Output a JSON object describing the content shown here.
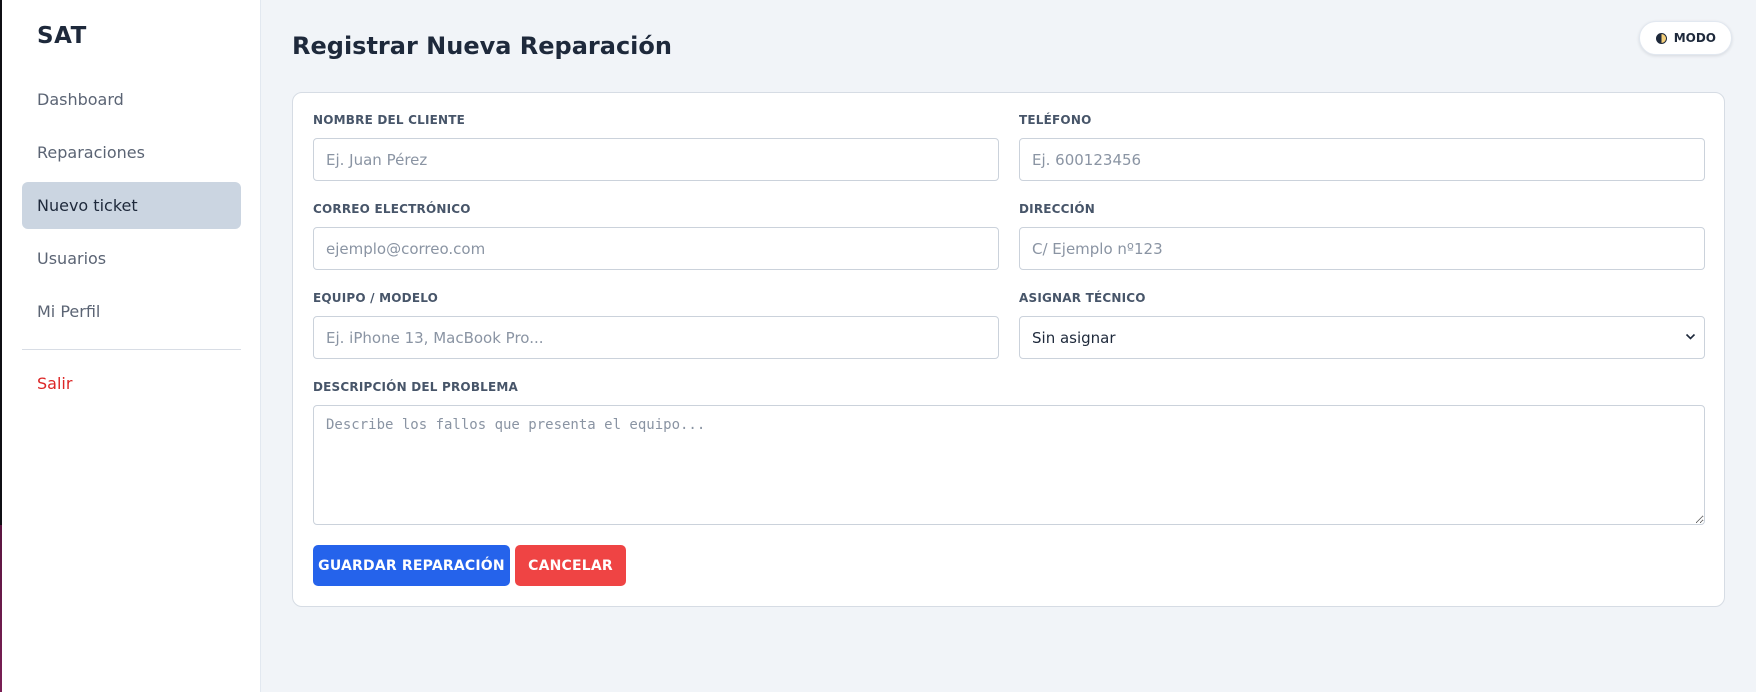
{
  "sidebar": {
    "brand": "SAT",
    "items": [
      {
        "label": "Dashboard"
      },
      {
        "label": "Reparaciones"
      },
      {
        "label": "Nuevo ticket"
      },
      {
        "label": "Usuarios"
      },
      {
        "label": "Mi Perfil"
      }
    ],
    "logout_label": "Salir"
  },
  "header": {
    "title": "Registrar Nueva Reparación",
    "mode_label": "MODO",
    "mode_icon": "half-moon-contrast-icon"
  },
  "form": {
    "cliente": {
      "label": "NOMBRE DEL CLIENTE",
      "placeholder": "Ej. Juan Pérez",
      "value": ""
    },
    "telefono": {
      "label": "TELÉFONO",
      "placeholder": "Ej. 600123456",
      "value": ""
    },
    "correo": {
      "label": "CORREO ELECTRÓNICO",
      "placeholder": "ejemplo@correo.com",
      "value": ""
    },
    "direccion": {
      "label": "DIRECCIÓN",
      "placeholder": "C/ Ejemplo nº123",
      "value": ""
    },
    "equipo": {
      "label": "EQUIPO / MODELO",
      "placeholder": "Ej. iPhone 13, MacBook Pro...",
      "value": ""
    },
    "tecnico": {
      "label": "ASIGNAR TÉCNICO",
      "selected": "Sin asignar"
    },
    "descripcion": {
      "label": "DESCRIPCIÓN DEL PROBLEMA",
      "placeholder": "Describe los fallos que presenta el equipo...",
      "value": ""
    },
    "save_label": "GUARDAR REPARACIÓN",
    "cancel_label": "CANCELAR"
  },
  "colors": {
    "primary": "#2563eb",
    "danger": "#ef4444",
    "active_nav": "#cbd5e1",
    "logout": "#dc2626",
    "background": "#f1f4f8"
  }
}
